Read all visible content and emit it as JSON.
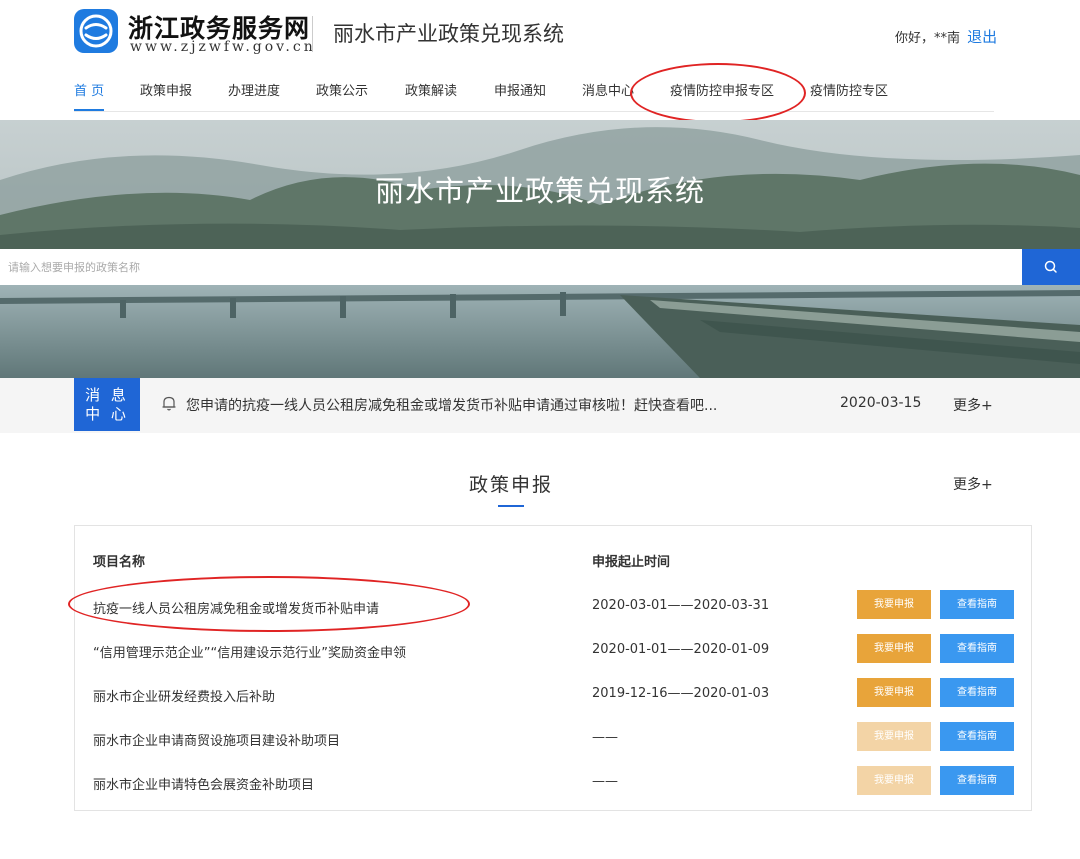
{
  "header": {
    "logo_title": "浙江政务服务网",
    "logo_subtitle": "www.zjzwfw.gov.cn",
    "system_title": "丽水市产业政策兑现系统",
    "greeting": "你好，**南",
    "logout_label": "退出"
  },
  "nav": {
    "items": [
      {
        "label": "首 页",
        "active": true
      },
      {
        "label": "政策申报"
      },
      {
        "label": "办理进度"
      },
      {
        "label": "政策公示"
      },
      {
        "label": "政策解读"
      },
      {
        "label": "申报通知"
      },
      {
        "label": "消息中心"
      },
      {
        "label": "疫情防控申报专区"
      },
      {
        "label": "疫情防控专区"
      }
    ]
  },
  "banner": {
    "title": "丽水市产业政策兑现系统",
    "search_placeholder": "请输入想要申报的政策名称",
    "search_icon": "search-icon"
  },
  "message_center": {
    "badge": "消息中心",
    "badge_line1": "消 息",
    "badge_line2": "中 心",
    "text": "您申请的抗疫一线人员公租房减免租金或增发货币补贴申请通过审核啦！赶快查看吧...",
    "date": "2020-03-15",
    "more": "更多+"
  },
  "policy": {
    "title": "政策申报",
    "more": "更多+",
    "columns": [
      "项目名称",
      "申报起止时间"
    ],
    "rows": [
      {
        "name": "抗疫一线人员公租房减免租金或增发货币补贴申请",
        "time": "2020-03-01——2020-03-31",
        "apply": "我要申报",
        "guide": "查看指南",
        "enabled": true
      },
      {
        "name": "“信用管理示范企业”“信用建设示范行业”奖励资金申领",
        "time": "2020-01-01——2020-01-09",
        "apply": "我要申报",
        "guide": "查看指南",
        "enabled": true
      },
      {
        "name": "丽水市企业研发经费投入后补助",
        "time": "2019-12-16——2020-01-03",
        "apply": "我要申报",
        "guide": "查看指南",
        "enabled": true
      },
      {
        "name": "丽水市企业申请商贸设施项目建设补助项目",
        "time": "——",
        "apply": "我要申报",
        "guide": "查看指南",
        "enabled": false
      },
      {
        "name": "丽水市企业申请特色会展资金补助项目",
        "time": "——",
        "apply": "我要申报",
        "guide": "查看指南",
        "enabled": false
      }
    ]
  },
  "colors": {
    "primary": "#1f66d6",
    "link_blue": "#1f7be0",
    "apply_orange": "#e8a43a",
    "apply_disabled": "#f3d4a6",
    "guide_blue": "#3a98f0",
    "annotation_red": "#e02424"
  }
}
